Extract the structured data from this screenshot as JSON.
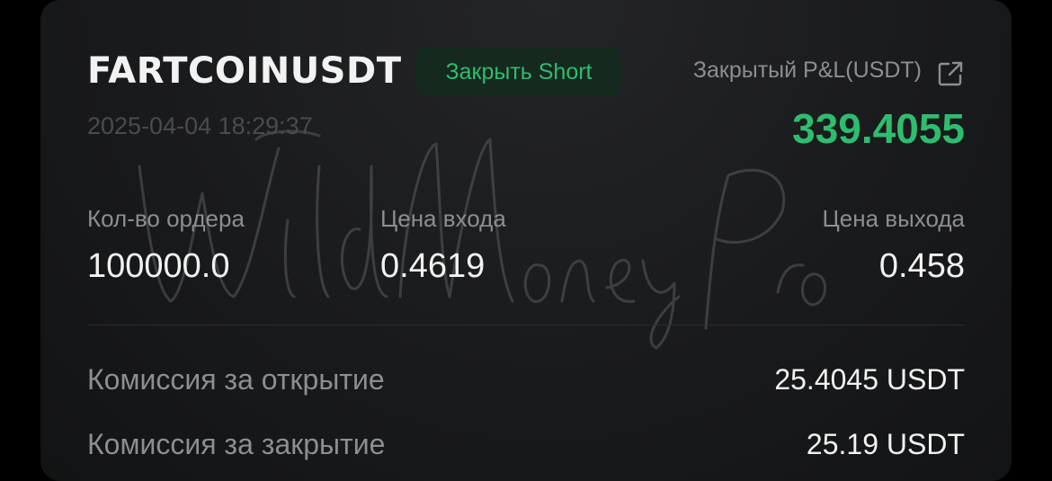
{
  "trade": {
    "symbol": "FARTCOINUSDT",
    "action_badge": "Закрыть Short",
    "datetime": "2025-04-04 18:29:37",
    "pnl_label": "Закрытый P&L(USDT)",
    "pnl_value": "339.4055"
  },
  "details": {
    "qty_label": "Кол-во ордера",
    "qty_value": "100000.0",
    "entry_label": "Цена входа",
    "entry_value": "0.4619",
    "exit_label": "Цена выхода",
    "exit_value": "0.458"
  },
  "fees": {
    "open_label": "Комиссия за открытие",
    "open_value": "25.4045 USDT",
    "close_label": "Комиссия за закрытие",
    "close_value": "25.19 USDT"
  },
  "watermark": {
    "text": "Wild Money Pro"
  },
  "icons": {
    "share": "external-link-icon"
  },
  "colors": {
    "profit_green": "#2ebd6e",
    "badge_bg": "#15291f",
    "primary_text": "#f2f2f2",
    "secondary_text": "#8c8e92"
  }
}
